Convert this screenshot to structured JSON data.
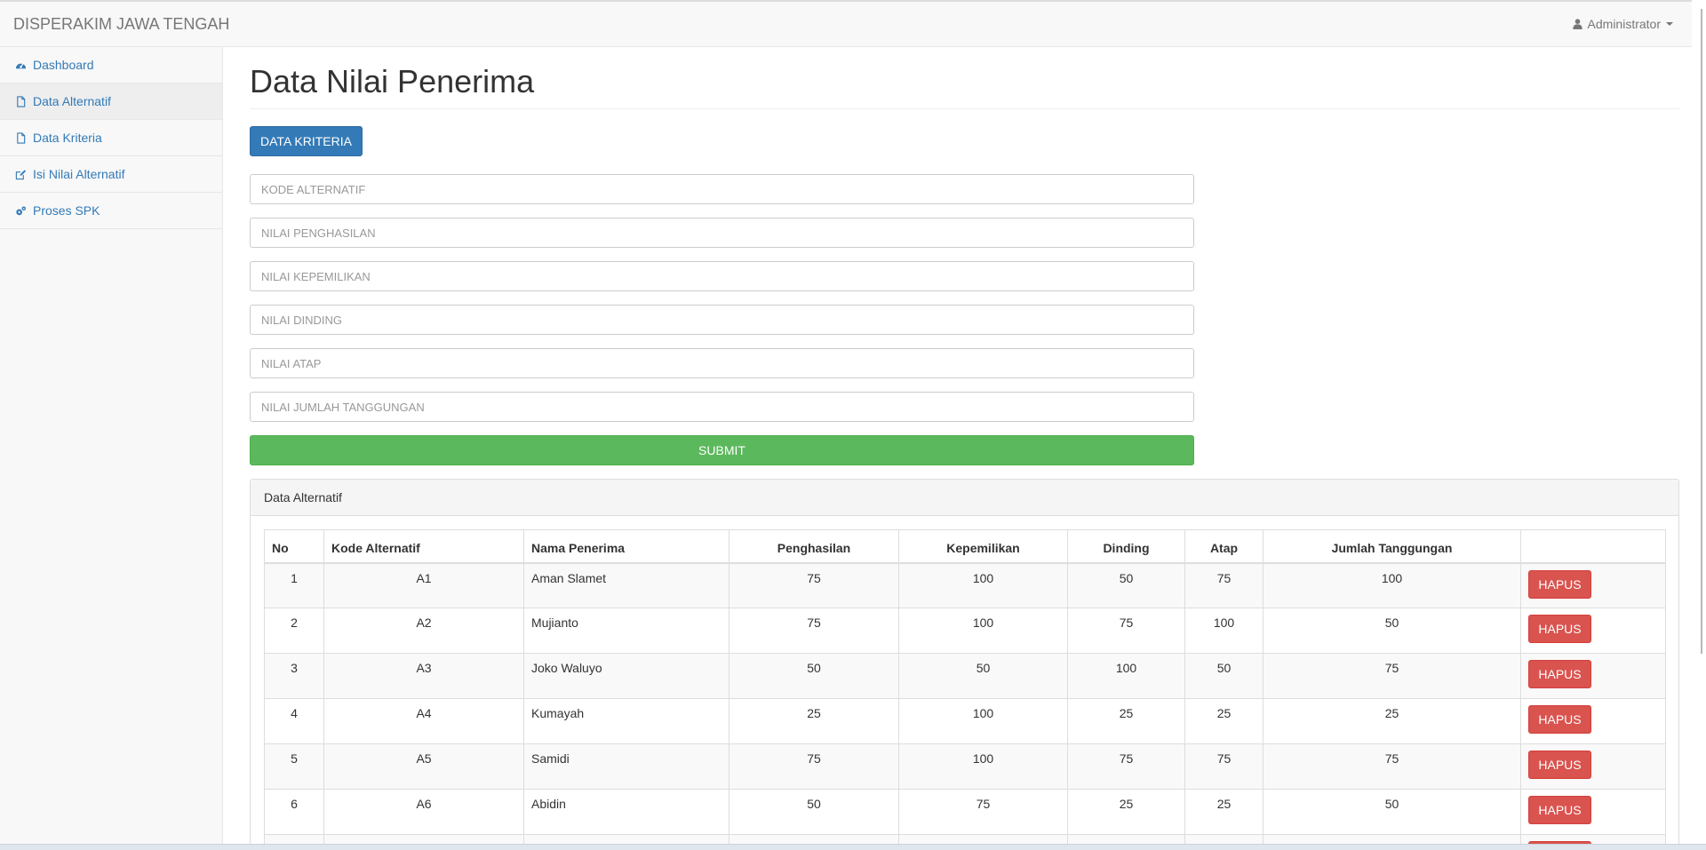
{
  "navbar": {
    "brand": "DISPERAKIM JAWA TENGAH",
    "user": "Administrator"
  },
  "sidebar": {
    "items": [
      {
        "label": "Dashboard",
        "icon": "dashboard-icon"
      },
      {
        "label": "Data Alternatif",
        "icon": "file-icon",
        "active": true
      },
      {
        "label": "Data Kriteria",
        "icon": "file-icon"
      },
      {
        "label": "Isi Nilai Alternatif",
        "icon": "edit-icon"
      },
      {
        "label": "Proses SPK",
        "icon": "gears-icon"
      }
    ]
  },
  "main": {
    "title": "Data Nilai Penerima",
    "kriteria_button": "DATA KRITERIA",
    "form": {
      "kode_placeholder": "KODE ALTERNATIF",
      "penghasilan_placeholder": "NILAI PENGHASILAN",
      "kepemilikan_placeholder": "NILAI KEPEMILIKAN",
      "dinding_placeholder": "NILAI DINDING",
      "atap_placeholder": "NILAI ATAP",
      "tanggungan_placeholder": "NILAI JUMLAH TANGGUNGAN",
      "submit_label": "SUBMIT"
    },
    "panel": {
      "heading": "Data Alternatif",
      "columns": [
        "No",
        "Kode Alternatif",
        "Nama Penerima",
        "Penghasilan",
        "Kepemilikan",
        "Dinding",
        "Atap",
        "Jumlah Tanggungan",
        ""
      ],
      "delete_label": "HAPUS",
      "rows": [
        {
          "no": "1",
          "kode": "A1",
          "nama": "Aman Slamet",
          "penghasilan": "75",
          "kepemilikan": "100",
          "dinding": "50",
          "atap": "75",
          "tanggungan": "100"
        },
        {
          "no": "2",
          "kode": "A2",
          "nama": "Mujianto",
          "penghasilan": "75",
          "kepemilikan": "100",
          "dinding": "75",
          "atap": "100",
          "tanggungan": "50"
        },
        {
          "no": "3",
          "kode": "A3",
          "nama": "Joko Waluyo",
          "penghasilan": "50",
          "kepemilikan": "50",
          "dinding": "100",
          "atap": "50",
          "tanggungan": "75"
        },
        {
          "no": "4",
          "kode": "A4",
          "nama": "Kumayah",
          "penghasilan": "25",
          "kepemilikan": "100",
          "dinding": "25",
          "atap": "25",
          "tanggungan": "25"
        },
        {
          "no": "5",
          "kode": "A5",
          "nama": "Samidi",
          "penghasilan": "75",
          "kepemilikan": "100",
          "dinding": "75",
          "atap": "75",
          "tanggungan": "75"
        },
        {
          "no": "6",
          "kode": "A6",
          "nama": "Abidin",
          "penghasilan": "50",
          "kepemilikan": "75",
          "dinding": "25",
          "atap": "25",
          "tanggungan": "50"
        }
      ]
    }
  },
  "colors": {
    "primary": "#337ab7",
    "success": "#5cb85c",
    "danger": "#d9534f",
    "navbar_bg": "#f8f8f8"
  }
}
